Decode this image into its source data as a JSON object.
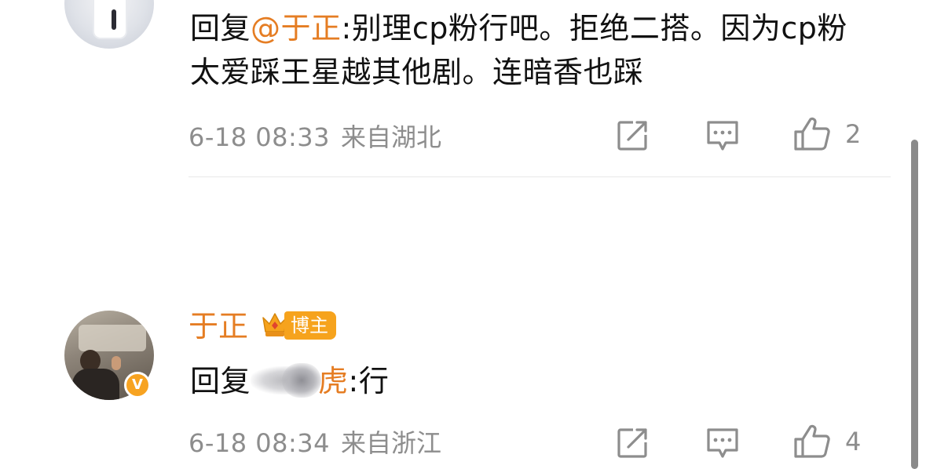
{
  "comments": [
    {
      "reply_prefix": "回复",
      "mention": "@于正",
      "text_after_mention": ":别理cp粉行吧。拒绝二搭。因为cp粉太爱踩王星越其他剧。连暗香也踩",
      "time": "6-18 08:33",
      "location": "来自湖北",
      "like_count": "2"
    },
    {
      "username": "于正",
      "badge_label": "博主",
      "reply_prefix": "回复",
      "mention_tail": "虎",
      "text_after_mention": ":行",
      "time": "6-18 08:34",
      "location": "来自浙江",
      "like_count": "4",
      "avatar_badge": "V"
    }
  ],
  "icons": {
    "share": "share-icon",
    "comment": "comment-icon",
    "like": "thumbs-up-icon",
    "crown": "crown-icon"
  },
  "colors": {
    "mention": "#e57d23",
    "username": "#e57d23",
    "badge": "#f6a31d",
    "meta": "#8d8d8d"
  }
}
